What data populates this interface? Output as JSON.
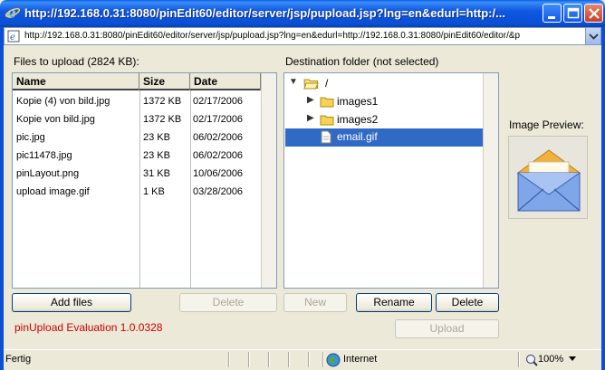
{
  "window": {
    "title": "http://192.168.0.31:8080/pinEdit60/editor/server/jsp/pupload.jsp?lng=en&edurl=http:/...",
    "icon": "ie-icon"
  },
  "address": {
    "url": "http://192.168.0.31:8080/pinEdit60/editor/server/jsp/pupload.jsp?lng=en&edurl=http://192.168.0.31:8080/pinEdit60/editor/&p"
  },
  "files": {
    "heading": "Files to upload (2824 KB):",
    "columns": [
      "Name",
      "Size",
      "Date"
    ],
    "rows": [
      [
        "Kopie (4) von bild.jpg",
        "1372 KB",
        "02/17/2006"
      ],
      [
        "Kopie von bild.jpg",
        "1372 KB",
        "02/17/2006"
      ],
      [
        "pic.jpg",
        "23 KB",
        "06/02/2006"
      ],
      [
        "pic11478.jpg",
        "23 KB",
        "06/02/2006"
      ],
      [
        "pinLayout.png",
        "31 KB",
        "10/06/2006"
      ],
      [
        "upload image.gif",
        "1 KB",
        "03/28/2006"
      ]
    ]
  },
  "destination": {
    "heading": "Destination folder (not selected)",
    "root": "/",
    "folders": [
      "images1",
      "images2"
    ],
    "selected_file": "email.gif"
  },
  "preview": {
    "label": "Image Preview:"
  },
  "buttons": {
    "add_files": "Add files",
    "delete_files": "Delete",
    "new": "New",
    "rename": "Rename",
    "delete_folder": "Delete",
    "upload": "Upload"
  },
  "evaluation": "pinUpload Evaluation 1.0.0328",
  "status": {
    "left": "Fertig",
    "zone": "Internet",
    "zoom": "100%"
  },
  "colors": {
    "selection": "#316ac5",
    "eval_text": "#cc0000",
    "titlebar": "#0a4fd6"
  }
}
